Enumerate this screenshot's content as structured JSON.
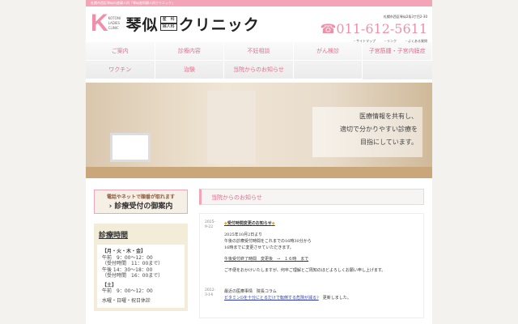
{
  "topbar": "札幌市西区琴似の産婦人科「琴似産科婦人科クリニック」",
  "logo": {
    "k": "K",
    "sub": "KOTONI LADIES CLINIC",
    "name": "琴似",
    "dept1": "産　科",
    "dept2": "婦人科",
    "name2": "クリニック"
  },
  "header": {
    "address": "札幌市西区琴似2条3丁目2-30",
    "phone": "☎011-612-5611",
    "links": [
      "・サイトマップ",
      "・リンク",
      "・よくある質問"
    ]
  },
  "nav": [
    "ご案内",
    "診療内容",
    "不妊相談",
    "がん検診",
    "子宮筋腫・子宮内膜症",
    "ワクチン",
    "治験",
    "当院からのお知らせ",
    ""
  ],
  "hero": {
    "line1": "医療情報を共有し、",
    "line2": "適切で分かりやすい診療を",
    "line3": "目指にしています。"
  },
  "sidebar": {
    "rsv_a": "電話やネットで順番が取れます",
    "rsv_b": "› 診療受付の御案内",
    "hours_title": "診療時間",
    "lines": [
      "【月・火・木・金】",
      "午前　9：00～12：00",
      "（受付時間　11：00まで）",
      "午後 14：30～18：00",
      "（受付時間　16：00まで）",
      "【土】",
      "午前　9：00～12：00",
      "水曜・日曜・祝日休診"
    ]
  },
  "news": {
    "heading": "当院からのお知らせ",
    "items": [
      {
        "date": "2025-9-22",
        "title": "受付時間変更のお知らせ",
        "p1": "2025年10月2日より",
        "p2": "午後の診療受付時間をこれまでの16時30分から",
        "p3": "16時までに変更させていただきます。",
        "p4": "午後受付終了時間　変更後　→　１６時　まで",
        "p5": "ご不便をおかけいたしますが、何卒ご理解とご周知のほどよろしくお願い申し上げます。"
      },
      {
        "date": "2022-3-14",
        "title": "最近の医療事情　院長コラム",
        "link": "ビタミンDを十分にとるだけで転倒する危険が減る?",
        "tail": "　更新しました。"
      }
    ]
  }
}
